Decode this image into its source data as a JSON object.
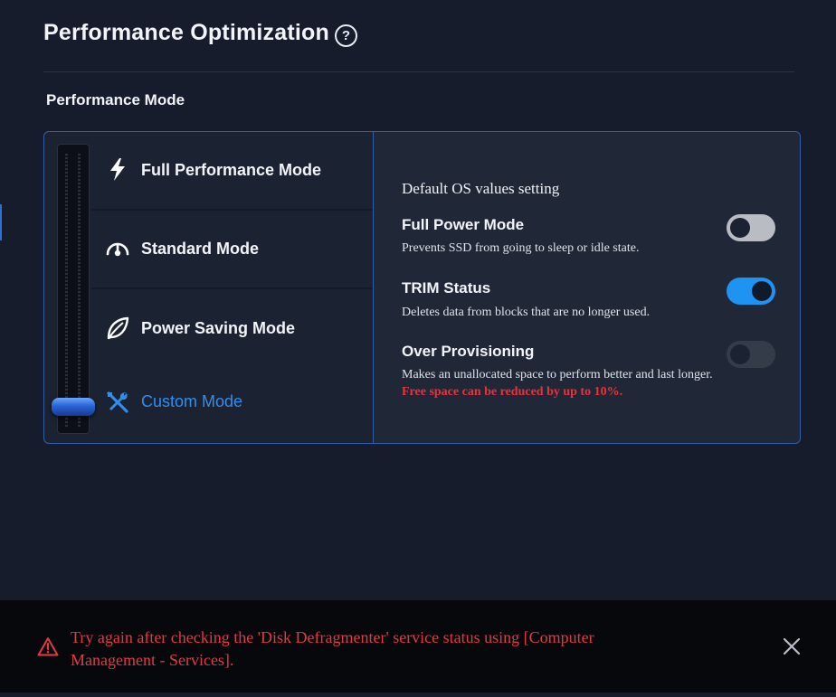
{
  "page": {
    "title": "Performance Optimization",
    "section_label": "Performance Mode"
  },
  "modes": [
    {
      "label": "Full Performance Mode",
      "icon": "lightning-bolt-icon"
    },
    {
      "label": "Standard Mode",
      "icon": "speedometer-icon"
    },
    {
      "label": "Power Saving Mode",
      "icon": "leaf-icon"
    },
    {
      "label": "Custom Mode",
      "icon": "wrench-screwdriver-icon",
      "selected": true
    }
  ],
  "settings": {
    "header": "Default OS values setting",
    "items": [
      {
        "title": "Full Power Mode",
        "description": "Prevents SSD from going to sleep or idle state.",
        "state": "off"
      },
      {
        "title": "TRIM Status",
        "description": "Deletes data from blocks that are no longer used.",
        "state": "on"
      },
      {
        "title": "Over Provisioning",
        "description": "Makes an unallocated space to perform better and last longer.",
        "warning": "Free space can be reduced by up to 10%.",
        "state": "disabled"
      }
    ]
  },
  "error": {
    "line1": "Try again after checking the 'Disk Defragmenter' service status using [Computer",
    "line2": "Management - Services]."
  },
  "colors": {
    "accent": "#2f8ff0",
    "toggle_on": "#1f93f2",
    "error": "#e23a44",
    "background": "#161c2b"
  }
}
